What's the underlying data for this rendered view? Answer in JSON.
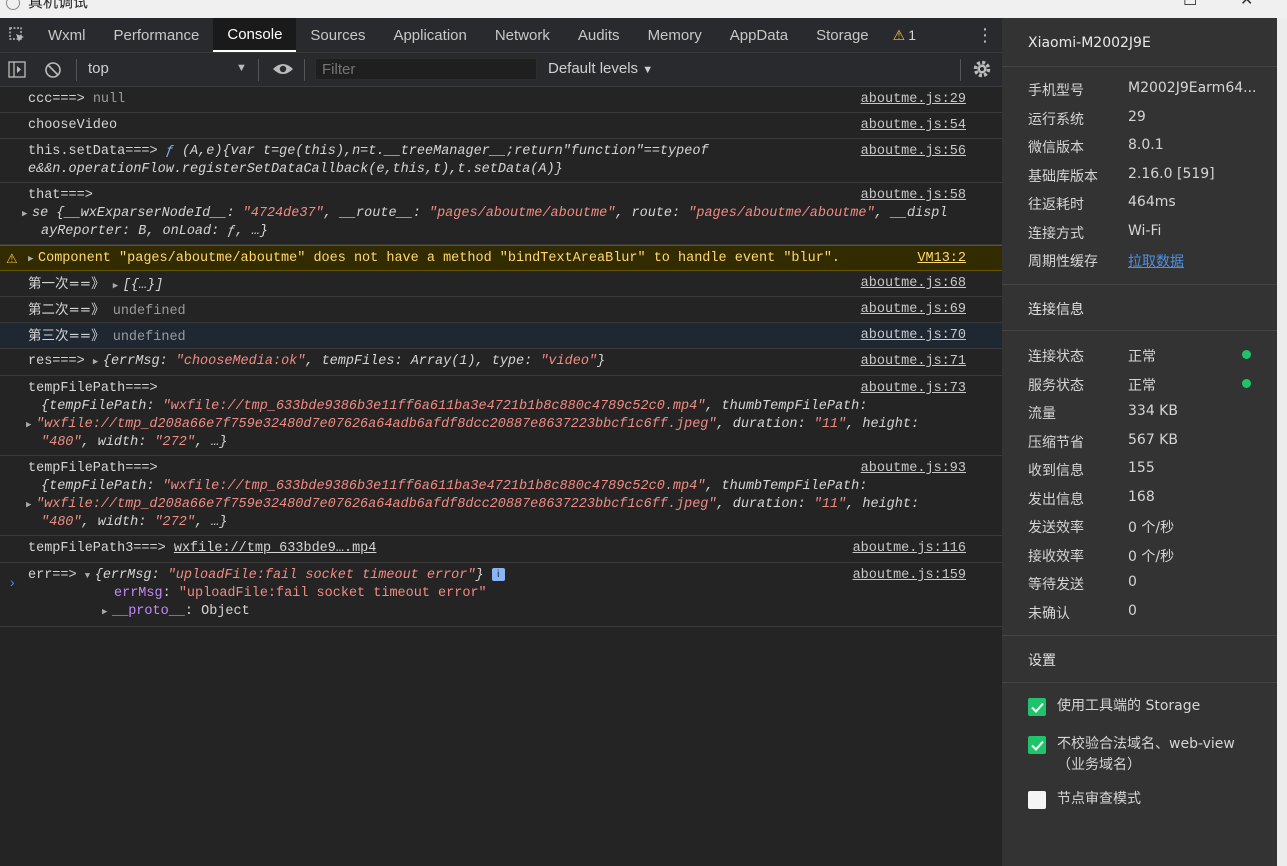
{
  "window": {
    "title": "真机调试"
  },
  "tabs": {
    "items": [
      "Wxml",
      "Performance",
      "Console",
      "Sources",
      "Application",
      "Network",
      "Audits",
      "Memory",
      "AppData",
      "Storage"
    ],
    "active_index": 2,
    "warning_count": "1"
  },
  "toolbar": {
    "context": "top",
    "filter_placeholder": "Filter",
    "levels": "Default levels"
  },
  "console": {
    "r1": {
      "label": "ccc===>",
      "value": "null",
      "src": "aboutme.js:29"
    },
    "r2": {
      "label": "chooseVideo",
      "src": "aboutme.js:54"
    },
    "r3": {
      "label": "this.setData===>",
      "fn": "ƒ",
      "line1": "(A,e){var t=ge(this),n=t.__treeManager__;return\"function\"==typeof",
      "line2": "e&&n.operationFlow.registerSetDataCallback(e,this,t),t.setData(A)}",
      "src": "aboutme.js:56"
    },
    "r4": {
      "label": "that===>",
      "src": "aboutme.js:58",
      "o1": "se {",
      "k1": "__wxExparserNodeId__",
      "v1": "\"4724de37\"",
      "k2": "__route__",
      "v2": "\"pages/aboutme/aboutme\"",
      "k3": "route",
      "v3": "\"pages/aboutme/aboutme\"",
      "k4": "__displ",
      "line2": "ayReporter: B, onLoad: ƒ, …}"
    },
    "r5": {
      "text": "Component \"pages/aboutme/aboutme\" does not have a method \"bindTextAreaBlur\" to handle event \"blur\".",
      "src": "VM13:2"
    },
    "r6": {
      "label": "第一次==》",
      "value": "[{…}]",
      "src": "aboutme.js:68"
    },
    "r7": {
      "label": "第二次==》",
      "value": "undefined",
      "src": "aboutme.js:69"
    },
    "r8": {
      "label": "第三次==》",
      "value": "undefined",
      "src": "aboutme.js:70"
    },
    "r9": {
      "label": "res===>",
      "o": "{",
      "k1": "errMsg",
      "v1": "\"chooseMedia:ok\"",
      "k2": "tempFiles",
      "v2": "Array(1)",
      "k3": "type",
      "v3": "\"video\"",
      "c": "}",
      "src": "aboutme.js:71"
    },
    "r10": {
      "label": "tempFilePath===>",
      "src": "aboutme.js:73",
      "o": "{",
      "k1": "tempFilePath",
      "v1": "\"wxfile://tmp_633bde9386b3e11ff6a611ba3e4721b1b8c880c4789c52c0.mp4\"",
      "k2": "thumbTempFilePath",
      "v2": "\"wxfile://tmp_d208a66e7f759e32480d7e07626a64adb6afdf8dcc20887e8637223bbcf1c6ff.jpeg\"",
      "k3": "duration",
      "v3": "\"11\"",
      "k4": "height",
      "v4": "\"480\"",
      "k5": "width",
      "v5": "\"272\"",
      "end": ", …}"
    },
    "r11": {
      "label": "tempFilePath===>",
      "src": "aboutme.js:93",
      "o": "{",
      "k1": "tempFilePath",
      "v1": "\"wxfile://tmp_633bde9386b3e11ff6a611ba3e4721b1b8c880c4789c52c0.mp4\"",
      "k2": "thumbTempFilePath",
      "v2": "\"wxfile://tmp_d208a66e7f759e32480d7e07626a64adb6afdf8dcc20887e8637223bbcf1c6ff.jpeg\"",
      "k3": "duration",
      "v3": "\"11\"",
      "k4": "height",
      "v4": "\"480\"",
      "k5": "width",
      "v5": "\"272\"",
      "end": ", …}"
    },
    "r12": {
      "label": "tempFilePath3===>",
      "link": "wxfile://tmp_633bde9….mp4",
      "src": "aboutme.js:116"
    },
    "r13": {
      "label": "err==>",
      "o": "{",
      "k1": "errMsg",
      "v1": "\"uploadFile:fail socket timeout error\"",
      "c": "}",
      "src": "aboutme.js:159",
      "prop_k": "errMsg",
      "prop_v": "\"uploadFile:fail socket timeout error\"",
      "proto_k": "__proto__",
      "proto_v": "Object",
      "badge": "i"
    }
  },
  "panel": {
    "device": "Xiaomi-M2002J9E",
    "info": [
      {
        "k": "手机型号",
        "v": "M2002J9Earm64..."
      },
      {
        "k": "运行系统",
        "v": "29"
      },
      {
        "k": "微信版本",
        "v": "8.0.1"
      },
      {
        "k": "基础库版本",
        "v": "2.16.0 [519]"
      },
      {
        "k": "往返耗时",
        "v": "464ms"
      },
      {
        "k": "连接方式",
        "v": "Wi-Fi"
      },
      {
        "k": "周期性缓存",
        "v": "拉取数据"
      }
    ],
    "conn_title": "连接信息",
    "conn": [
      {
        "k": "连接状态",
        "v": "正常"
      },
      {
        "k": "服务状态",
        "v": "正常"
      },
      {
        "k": "流量",
        "v": "334 KB"
      },
      {
        "k": "压缩节省",
        "v": "567 KB"
      },
      {
        "k": "收到信息",
        "v": "155"
      },
      {
        "k": "发出信息",
        "v": "168"
      },
      {
        "k": "发送效率",
        "v": "0 个/秒"
      },
      {
        "k": "接收效率",
        "v": "0 个/秒"
      },
      {
        "k": "等待发送",
        "v": "0"
      },
      {
        "k": "未确认",
        "v": "0"
      }
    ],
    "settings_title": "设置",
    "settings": [
      {
        "label": "使用工具端的 Storage",
        "checked": true
      },
      {
        "label": "不校验合法域名、web-view（业务域名）",
        "checked": true
      },
      {
        "label": "节点审查模式",
        "checked": false
      }
    ]
  },
  "colors": {
    "accent": "#1fc46a",
    "link": "#4d8fe6",
    "string": "#f28b82",
    "warning_bg": "#332b00"
  }
}
